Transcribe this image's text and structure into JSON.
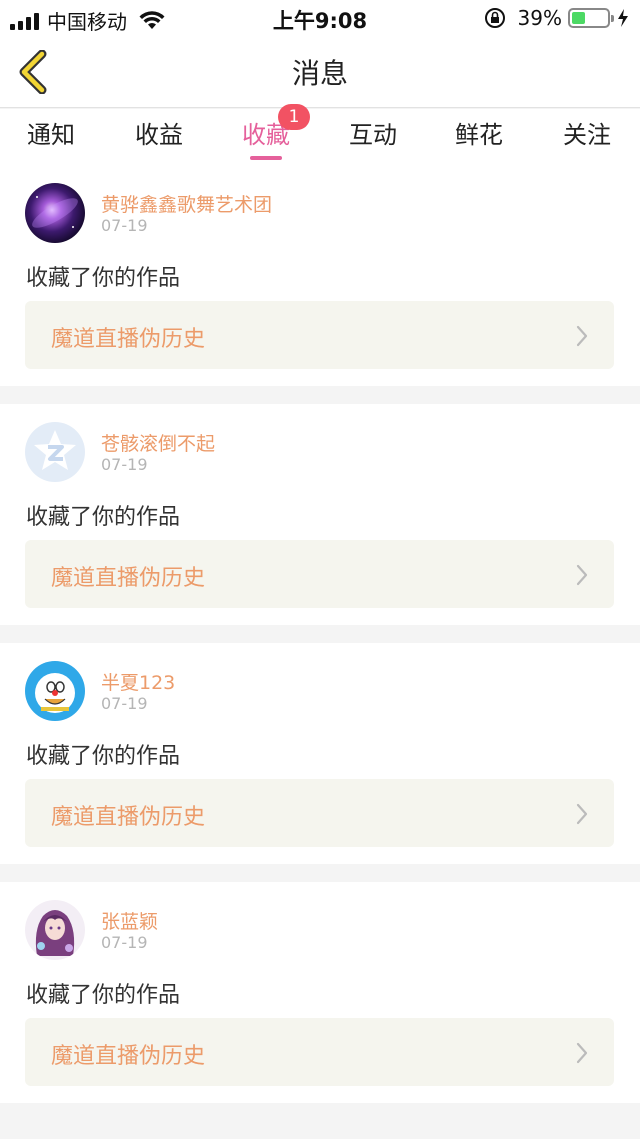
{
  "status_bar": {
    "carrier": "中国移动",
    "time": "上午9:08",
    "battery_percent": "39%",
    "battery_level": 0.39
  },
  "nav": {
    "title": "消息",
    "back_icon": "chevron-left-icon",
    "accent_color": "#f2d534"
  },
  "tabs": [
    {
      "label": "通知",
      "active": false
    },
    {
      "label": "收益",
      "active": false
    },
    {
      "label": "收藏",
      "active": true,
      "badge": "1"
    },
    {
      "label": "互动",
      "active": false
    },
    {
      "label": "鲜花",
      "active": false
    },
    {
      "label": "关注",
      "active": false
    }
  ],
  "colors": {
    "active_tab": "#e5609b",
    "badge": "#f25263",
    "username": "#ec9b6a",
    "work_title": "#ec9b6a"
  },
  "messages": [
    {
      "username": "黄骅鑫鑫歌舞艺术团",
      "date": "07-19",
      "action": "收藏了你的作品",
      "work_title": "魔道直播伪历史",
      "avatar": "galaxy-avatar"
    },
    {
      "username": "苍骸滚倒不起",
      "date": "07-19",
      "action": "收藏了你的作品",
      "work_title": "魔道直播伪历史",
      "avatar": "default-z-avatar"
    },
    {
      "username": "半夏123",
      "date": "07-19",
      "action": "收藏了你的作品",
      "work_title": "魔道直播伪历史",
      "avatar": "cartoon-cat-avatar"
    },
    {
      "username": "张蓝颖",
      "date": "07-19",
      "action": "收藏了你的作品",
      "work_title": "魔道直播伪历史",
      "avatar": "anime-girl-avatar"
    }
  ]
}
